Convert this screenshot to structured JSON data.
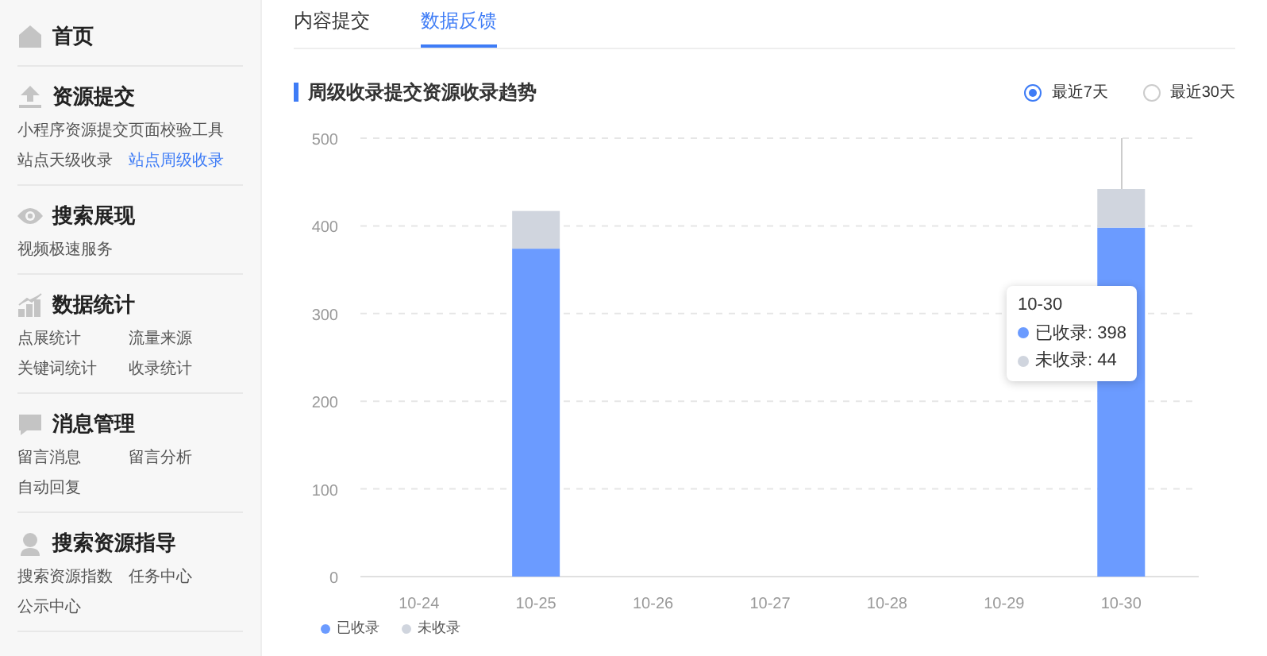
{
  "sidebar": {
    "sections": [
      {
        "title": "首页"
      },
      {
        "title": "资源提交",
        "items": [
          {
            "label": "小程序资源提交",
            "selected": false
          },
          {
            "label": "页面校验工具",
            "selected": false
          },
          {
            "label": "站点天级收录",
            "selected": false
          },
          {
            "label": "站点周级收录",
            "selected": true
          }
        ]
      },
      {
        "title": "搜索展现",
        "items": [
          {
            "label": "视频极速服务",
            "selected": false
          }
        ]
      },
      {
        "title": "数据统计",
        "items": [
          {
            "label": "点展统计",
            "selected": false
          },
          {
            "label": "流量来源",
            "selected": false
          },
          {
            "label": "关键词统计",
            "selected": false
          },
          {
            "label": "收录统计",
            "selected": false
          }
        ]
      },
      {
        "title": "消息管理",
        "items": [
          {
            "label": "留言消息",
            "selected": false
          },
          {
            "label": "留言分析",
            "selected": false
          },
          {
            "label": "自动回复",
            "selected": false
          }
        ]
      },
      {
        "title": "搜索资源指导",
        "items": [
          {
            "label": "搜索资源指数",
            "selected": false
          },
          {
            "label": "任务中心",
            "selected": false
          },
          {
            "label": "公示中心",
            "selected": false
          }
        ]
      }
    ]
  },
  "tabs": [
    {
      "label": "内容提交",
      "selected": false
    },
    {
      "label": "数据反馈",
      "selected": true
    }
  ],
  "panel": {
    "title": "周级收录提交资源收录趋势",
    "range_options": [
      {
        "label": "最近7天",
        "selected": true
      },
      {
        "label": "最近30天",
        "selected": false
      }
    ],
    "chart_data": {
      "type": "bar",
      "stacked": true,
      "grid": true,
      "legend": true,
      "categories": [
        "10-24",
        "10-25",
        "10-26",
        "10-27",
        "10-28",
        "10-29",
        "10-30"
      ],
      "ylim": [
        0,
        500
      ],
      "yticks": [
        0,
        100,
        200,
        300,
        400,
        500
      ],
      "series": [
        {
          "name": "已收录",
          "color": "#6b9bff",
          "values": [
            0,
            374,
            0,
            0,
            0,
            0,
            398
          ]
        },
        {
          "name": "未收录",
          "color": "#d0d5de",
          "values": [
            0,
            43,
            0,
            0,
            0,
            0,
            44
          ]
        }
      ]
    },
    "tooltip": {
      "title": "10-30",
      "items": [
        {
          "label": "已收录: 398",
          "color": "#6b9bff"
        },
        {
          "label": "未收录: 44",
          "color": "#d0d5de"
        }
      ]
    }
  }
}
